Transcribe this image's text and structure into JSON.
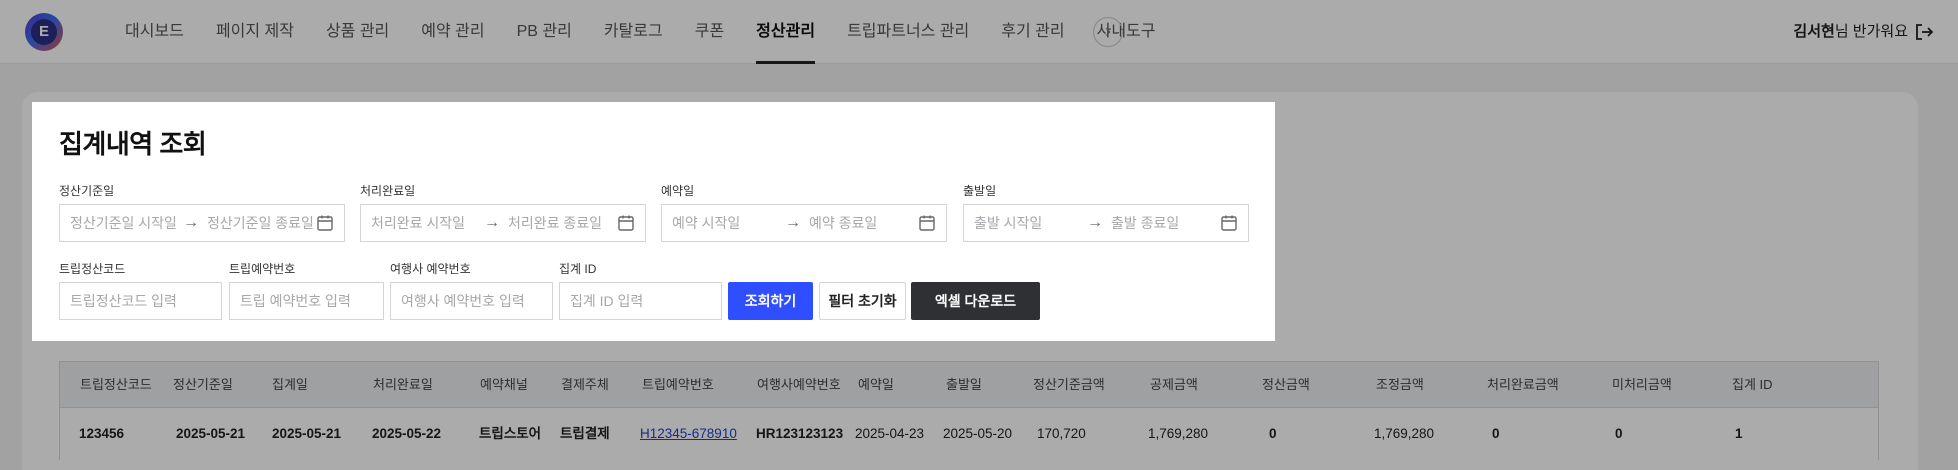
{
  "header": {
    "logo_letter": "E",
    "nav_items": [
      "대시보드",
      "페이지 제작",
      "상품 관리",
      "예약 관리",
      "PB 관리",
      "카탈로그",
      "쿠폰",
      "정산관리",
      "트립파트너스 관리",
      "후기 관리",
      "사내도구"
    ],
    "active_nav": "정산관리",
    "more_arrow": "›",
    "user_name": "김서현",
    "user_greeting_suffix": "님 반가워요"
  },
  "modal": {
    "title": "집계내역 조회",
    "date_filters": [
      {
        "label": "정산기준일",
        "start_placeholder": "정산기준일 시작일",
        "end_placeholder": "정산기준일 종료일"
      },
      {
        "label": "처리완료일",
        "start_placeholder": "처리완료 시작일",
        "end_placeholder": "처리완료 종료일"
      },
      {
        "label": "예약일",
        "start_placeholder": "예약 시작일",
        "end_placeholder": "예약 종료일"
      },
      {
        "label": "출발일",
        "start_placeholder": "출발 시작일",
        "end_placeholder": "출발 종료일"
      }
    ],
    "date_arrow": "→",
    "text_filters": [
      {
        "label": "트립정산코드",
        "placeholder": "트립정산코드 입력"
      },
      {
        "label": "트립예약번호",
        "placeholder": "트립 예약번호 입력"
      },
      {
        "label": "여행사 예약번호",
        "placeholder": "여행사 예약번호 입력"
      },
      {
        "label": "집계 ID",
        "placeholder": "집계 ID 입력"
      }
    ],
    "buttons": {
      "search": "조회하기",
      "reset": "필터 초기화",
      "excel": "엑셀 다운로드"
    }
  },
  "table": {
    "headers": [
      "트립정산코드",
      "정산기준일",
      "집계일",
      "처리완료일",
      "예약채널",
      "결제주체",
      "트립예약번호",
      "여행사예약번호",
      "예약일",
      "출발일",
      "정산기준금액",
      "공제금액",
      "정산금액",
      "조정금액",
      "처리완료금액",
      "미처리금액",
      "집계 ID"
    ],
    "rows": [
      [
        "123456",
        "2025-05-21",
        "2025-05-21",
        "2025-05-22",
        "트립스토어",
        "트립결제",
        "H12345-678910",
        "HR123123123",
        "2025-04-23",
        "2025-05-20",
        "170,720",
        "1,769,280",
        "0",
        "1,769,280",
        "0",
        "0",
        "1"
      ]
    ]
  },
  "colors": {
    "primary": "#2f4eff",
    "dark_button": "#2e3033",
    "link": "#1f45c9"
  }
}
